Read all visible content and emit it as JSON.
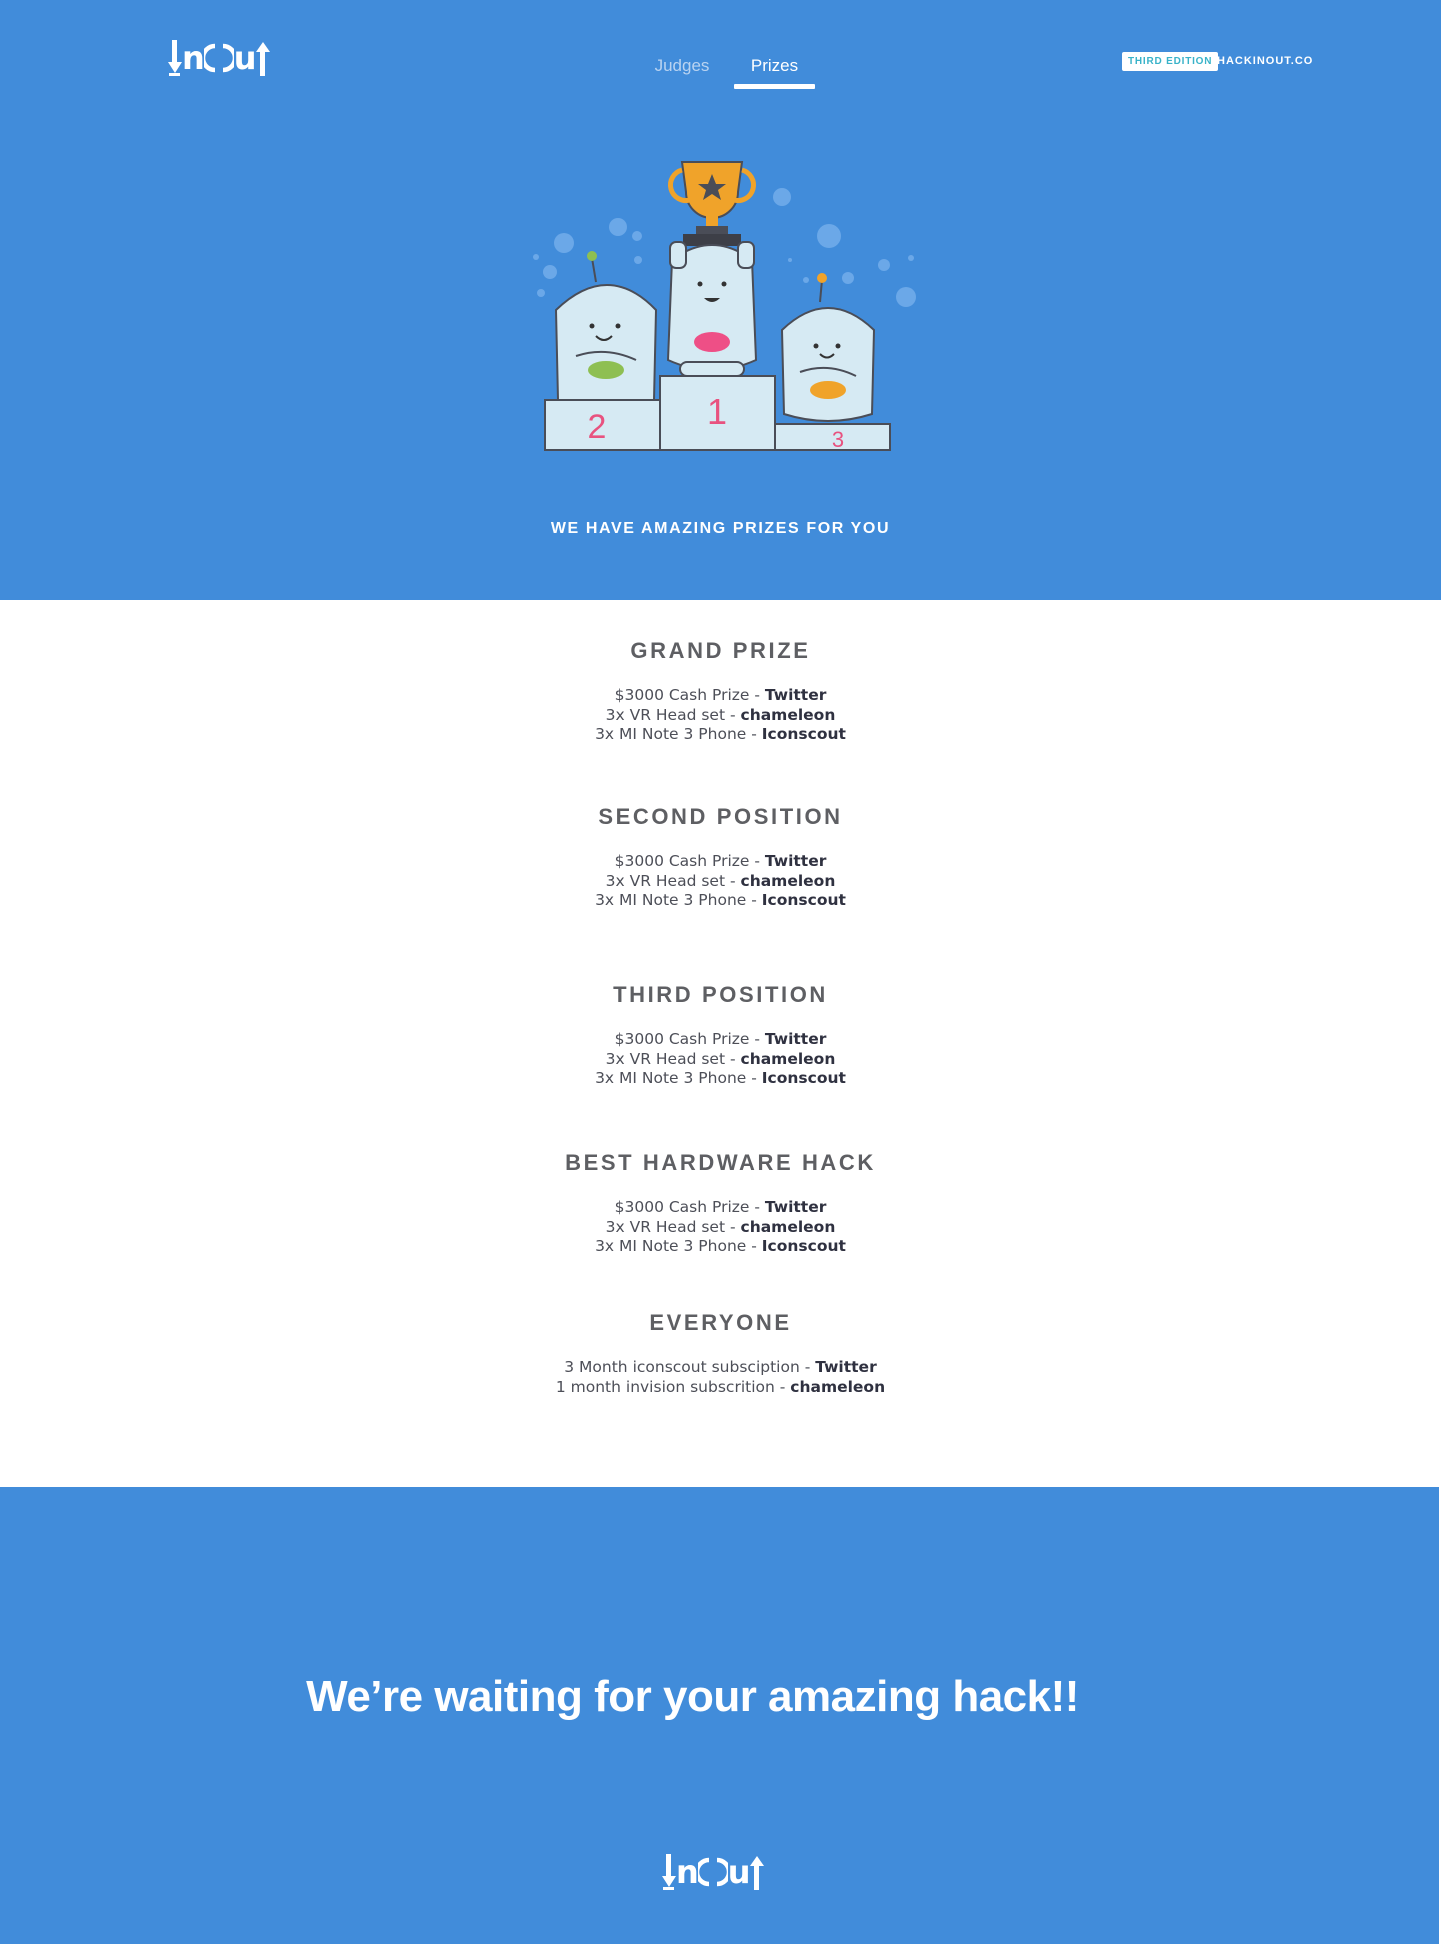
{
  "header": {
    "logo_text": "InOut",
    "nav": [
      {
        "label": "Judges",
        "active": false
      },
      {
        "label": "Prizes",
        "active": true
      }
    ],
    "badge": "THIRD EDITION",
    "site": "HACKINOUT.CO"
  },
  "hero": {
    "podium_numbers": [
      "2",
      "1",
      "3"
    ],
    "tagline": "WE  HAVE AMAZING PRIZES FOR YOU"
  },
  "prizes": [
    {
      "title": "GRAND PRIZE",
      "lines": [
        {
          "text": "$3000 Cash Prize - ",
          "sponsor": "Twitter"
        },
        {
          "text": "3x VR Head set - ",
          "sponsor": "chameleon"
        },
        {
          "text": "3x MI Note 3 Phone - ",
          "sponsor": "Iconscout"
        }
      ]
    },
    {
      "title": "SECOND POSITION",
      "lines": [
        {
          "text": "$3000 Cash Prize - ",
          "sponsor": "Twitter"
        },
        {
          "text": "3x VR Head set - ",
          "sponsor": "chameleon"
        },
        {
          "text": "3x MI Note 3 Phone - ",
          "sponsor": "Iconscout"
        }
      ]
    },
    {
      "title": "THIRD POSITION",
      "lines": [
        {
          "text": "$3000 Cash Prize - ",
          "sponsor": "Twitter"
        },
        {
          "text": "3x VR Head set - ",
          "sponsor": "chameleon"
        },
        {
          "text": "3x MI Note 3 Phone - ",
          "sponsor": "Iconscout"
        }
      ]
    },
    {
      "title": "BEST HARDWARE HACK",
      "lines": [
        {
          "text": "$3000 Cash Prize - ",
          "sponsor": "Twitter"
        },
        {
          "text": "3x VR Head set - ",
          "sponsor": "chameleon"
        },
        {
          "text": "3x MI Note 3 Phone - ",
          "sponsor": "Iconscout"
        }
      ]
    },
    {
      "title": "EVERYONE",
      "lines": [
        {
          "text": "3 Month iconscout subsciption - ",
          "sponsor": "Twitter"
        },
        {
          "text": "1 month invision subscrition - ",
          "sponsor": "chameleon"
        }
      ]
    }
  ],
  "footer": {
    "message": "We’re waiting for your amazing hack!!",
    "logo_text": "InOut"
  },
  "colors": {
    "brand_blue": "#418cda",
    "heading_gray": "#5e5f63",
    "body_text": "#4d4f58",
    "podium_number_pink": "#e8527f",
    "badge_teal": "#39b3c9",
    "trophy_gold": "#f0a32a"
  },
  "icons": [
    "down-arrow-icon",
    "up-arrow-icon",
    "trophy-icon",
    "star-icon"
  ]
}
